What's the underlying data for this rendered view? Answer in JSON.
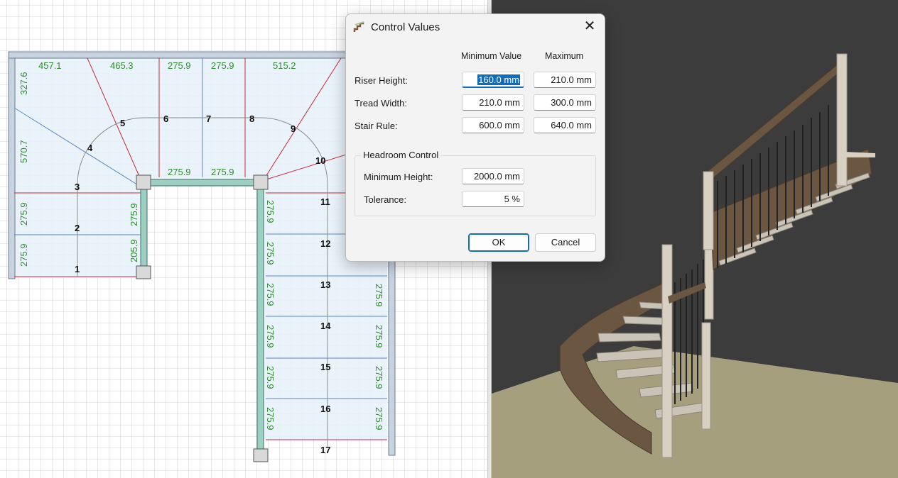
{
  "plan": {
    "top_dimensions": [
      "457.1",
      "465.3",
      "275.9",
      "275.9",
      "515.2"
    ],
    "left_dimensions": [
      "327.6",
      "570.7",
      "275.9",
      "275.9"
    ],
    "inner_dimensions": {
      "post_edge_a": "275.9",
      "post_edge_b": "275.9",
      "left_post_upper": "275.9",
      "left_post_lower": "205.9",
      "center_stringer": [
        "275.9",
        "275.9",
        "275.9",
        "275.9",
        "275.9",
        "275.9"
      ],
      "right_stringer": [
        "275.9",
        "275.9",
        "275.9",
        "275.9"
      ]
    },
    "step_numbers": [
      "1",
      "2",
      "3",
      "4",
      "5",
      "6",
      "7",
      "8",
      "9",
      "10",
      "11",
      "12",
      "13",
      "14",
      "15",
      "16",
      "17"
    ],
    "colors": {
      "grid": "#c9d4e4",
      "stair_fill": "#e5f1f8",
      "dim_text": "#2e8b2e",
      "red_line": "#c9283c",
      "blue_line": "#5b86c8",
      "post": "#9ccfc2"
    }
  },
  "view3d": {
    "colors": {
      "background": "#3c3c3c",
      "floor": "#a59f7e",
      "wood": "#6b5642",
      "tread": "#c9c3b8",
      "post": "#d8d0c2"
    }
  },
  "dialog": {
    "title": "Control Values",
    "icon": "staircase-icon",
    "close_label": "✕",
    "columns": {
      "min": "Minimum Value",
      "max": "Maximum"
    },
    "rows": [
      {
        "label": "Riser Height:",
        "min": "160.0 mm",
        "max": "210.0 mm"
      },
      {
        "label": "Tread Width:",
        "min": "210.0 mm",
        "max": "300.0 mm"
      },
      {
        "label": "Stair Rule:",
        "min": "600.0 mm",
        "max": "640.0 mm"
      }
    ],
    "headroom": {
      "title": "Headroom Control",
      "min_height_label": "Minimum Height:",
      "min_height_value": "2000.0 mm",
      "tolerance_label": "Tolerance:",
      "tolerance_value": "5 %"
    },
    "ok_label": "OK",
    "cancel_label": "Cancel",
    "accent": "#0f6cbd"
  }
}
